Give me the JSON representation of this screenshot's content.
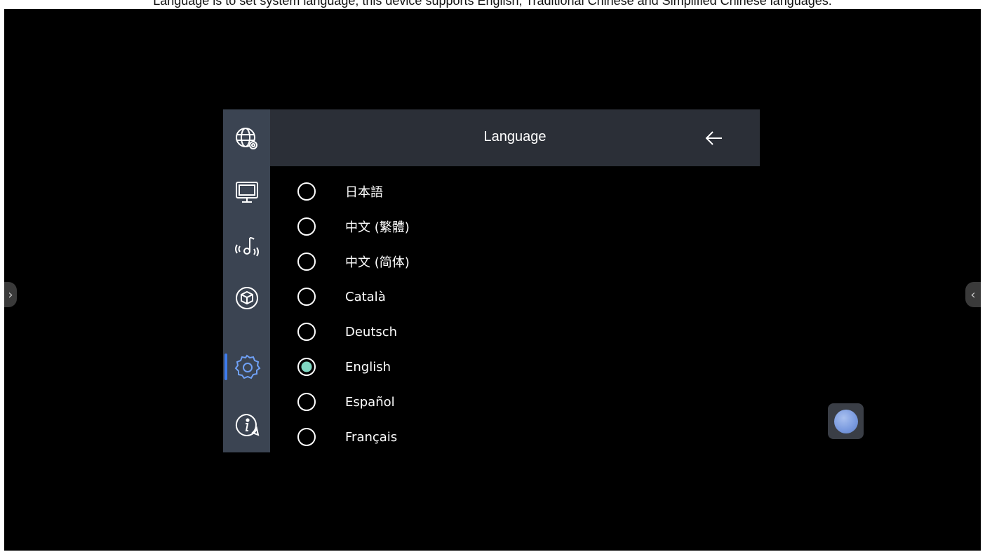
{
  "caption": "Language is to set system language, this device supports English, Traditional Chinese and Simplified Chinese languages.",
  "edges": {
    "left_arrow": "›",
    "right_arrow": "‹"
  },
  "sidebar": {
    "items": [
      {
        "icon": "globe-settings-icon",
        "active": false
      },
      {
        "icon": "monitor-icon",
        "active": false
      },
      {
        "icon": "audio-sound-icon",
        "active": false
      },
      {
        "icon": "cube-icon",
        "active": false
      },
      {
        "icon": "gear-icon",
        "active": true
      },
      {
        "icon": "info-icon",
        "active": false
      }
    ]
  },
  "header": {
    "title": "Language",
    "back_icon": "arrow-left-icon"
  },
  "languages": [
    {
      "label": "日本語",
      "selected": false
    },
    {
      "label": "中文 (繁體)",
      "selected": false
    },
    {
      "label": "中文 (简体)",
      "selected": false
    },
    {
      "label": "Català",
      "selected": false
    },
    {
      "label": "Deutsch",
      "selected": false
    },
    {
      "label": "English",
      "selected": true
    },
    {
      "label": "Español",
      "selected": false
    },
    {
      "label": "Français",
      "selected": false
    }
  ],
  "colors": {
    "sidebar_bg": "#3b4452",
    "header_bg": "#2b2f37",
    "accent": "#3d7cf0",
    "radio_selected": "#7fd6c2",
    "icon_color": "#ffffff",
    "gear_active": "#6fa0f5"
  }
}
